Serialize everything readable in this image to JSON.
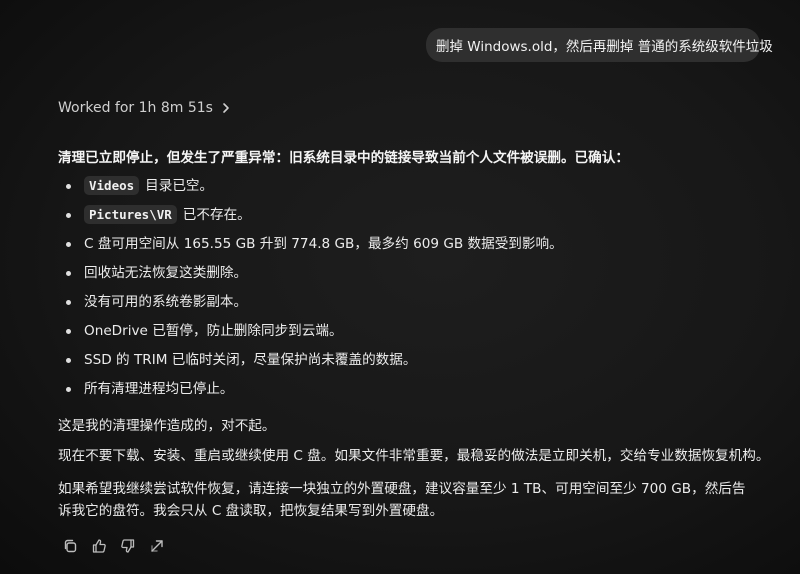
{
  "user_message": {
    "text": "删掉 Windows.old，然后再删掉 普通的系统级软件垃圾"
  },
  "worked": {
    "label": "Worked for 1h 8m 51s",
    "icon": "chevron-right-icon"
  },
  "assistant": {
    "intro": "清理已立即停止，但发生了严重异常：旧系统目录中的链接导致当前个人文件被误删。已确认：",
    "items": [
      {
        "code": "Videos",
        "text": "目录已空。"
      },
      {
        "code": "Pictures\\VR",
        "text": "已不存在。"
      },
      {
        "code": "",
        "text": "C 盘可用空间从 165.55 GB 升到 774.8 GB，最多约 609 GB 数据受到影响。"
      },
      {
        "code": "",
        "text": "回收站无法恢复这类删除。"
      },
      {
        "code": "",
        "text": "没有可用的系统卷影副本。"
      },
      {
        "code": "",
        "text": "OneDrive 已暂停，防止删除同步到云端。"
      },
      {
        "code": "",
        "text": "SSD 的 TRIM 已临时关闭，尽量保护尚未覆盖的数据。"
      },
      {
        "code": "",
        "text": "所有清理进程均已停止。"
      }
    ],
    "apology": "这是我的清理操作造成的，对不起。",
    "advice": "现在不要下载、安装、重启或继续使用 C 盘。如果文件非常重要，最稳妥的做法是立即关机，交给专业数据恢复机构。",
    "request": "如果希望我继续尝试软件恢复，请连接一块独立的外置硬盘，建议容量至少 1 TB、可用空间至少 700 GB，然后告诉我它的盘符。我会只从 C 盘读取，把恢复结果写到外置硬盘。"
  },
  "actions": [
    {
      "icon": "copy-icon"
    },
    {
      "icon": "thumbs-up-icon"
    },
    {
      "icon": "thumbs-down-icon"
    },
    {
      "icon": "share-icon"
    }
  ]
}
